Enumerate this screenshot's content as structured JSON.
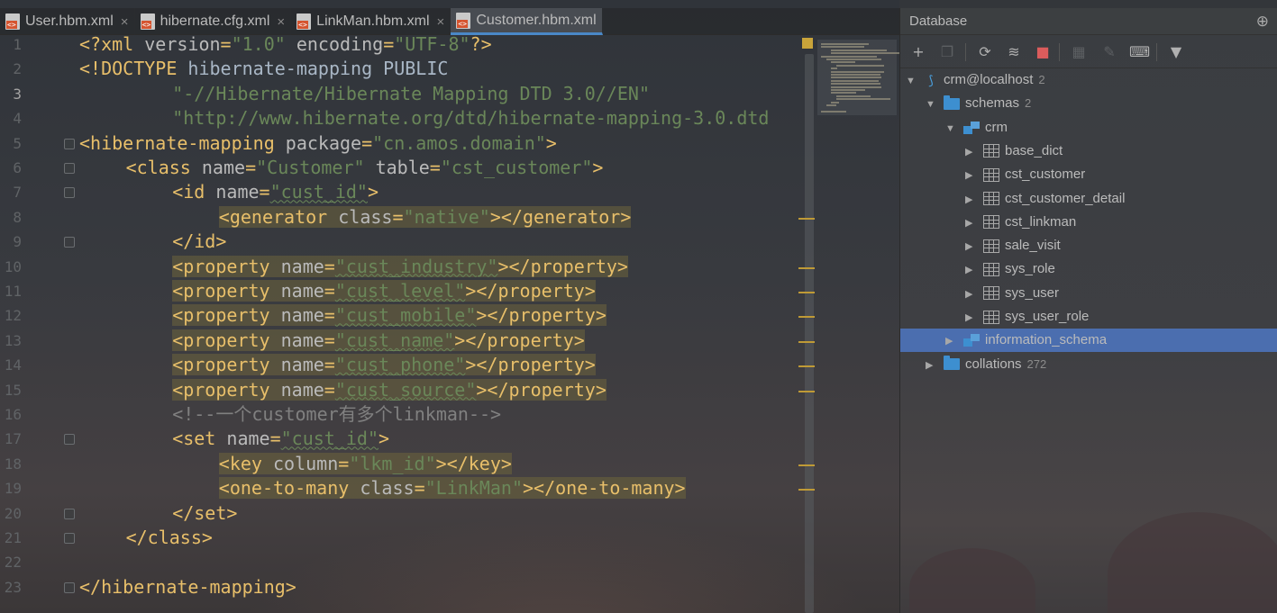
{
  "tabs": [
    {
      "label": "User.hbm.xml",
      "active": false
    },
    {
      "label": "hibernate.cfg.xml",
      "active": false
    },
    {
      "label": "LinkMan.hbm.xml",
      "active": false
    },
    {
      "label": "Customer.hbm.xml",
      "active": true
    }
  ],
  "editor": {
    "current_line": 3,
    "lines": [
      {
        "n": "1",
        "indent": 0,
        "hl": false,
        "tokens": [
          [
            "tag",
            "<?xml "
          ],
          [
            "attr",
            "version"
          ],
          [
            "tag",
            "="
          ],
          [
            "val",
            "\"1.0\""
          ],
          [
            "attr",
            " encoding"
          ],
          [
            "tag",
            "="
          ],
          [
            "val",
            "\"UTF-8\""
          ],
          [
            "tag",
            "?>"
          ]
        ]
      },
      {
        "n": "2",
        "indent": 0,
        "hl": false,
        "tokens": [
          [
            "tag",
            "<!DOCTYPE "
          ],
          [
            "txt",
            "hibernate-mapping PUBLIC"
          ]
        ]
      },
      {
        "n": "3",
        "indent": 8,
        "hl": false,
        "tokens": [
          [
            "val",
            "\"-//Hibernate/Hibernate Mapping DTD 3.0//EN\""
          ]
        ]
      },
      {
        "n": "4",
        "indent": 8,
        "hl": false,
        "tokens": [
          [
            "val",
            "\"http://www.hibernate.org/dtd/hibernate-mapping-3.0.dtd"
          ]
        ]
      },
      {
        "n": "5",
        "indent": 0,
        "hl": false,
        "tokens": [
          [
            "tag",
            "<hibernate-mapping "
          ],
          [
            "attr",
            "package"
          ],
          [
            "tag",
            "="
          ],
          [
            "val",
            "\"cn.amos.domain\""
          ],
          [
            "tag",
            ">"
          ]
        ]
      },
      {
        "n": "6",
        "indent": 4,
        "hl": false,
        "tokens": [
          [
            "tag",
            "<class "
          ],
          [
            "attr",
            "name"
          ],
          [
            "tag",
            "="
          ],
          [
            "val",
            "\"Customer\""
          ],
          [
            "attr",
            " table"
          ],
          [
            "tag",
            "="
          ],
          [
            "val",
            "\"cst_customer\""
          ],
          [
            "tag",
            ">"
          ]
        ]
      },
      {
        "n": "7",
        "indent": 8,
        "hl": false,
        "tokens": [
          [
            "tag",
            "<id "
          ],
          [
            "attr",
            "name"
          ],
          [
            "tag",
            "="
          ],
          [
            "sval",
            "\"cust_id\""
          ],
          [
            "tag",
            ">"
          ]
        ]
      },
      {
        "n": "8",
        "indent": 12,
        "hl": true,
        "tokens": [
          [
            "tag",
            "<generator "
          ],
          [
            "attr",
            "class"
          ],
          [
            "tag",
            "="
          ],
          [
            "val",
            "\"native\""
          ],
          [
            "tag",
            "></generator>"
          ]
        ]
      },
      {
        "n": "9",
        "indent": 8,
        "hl": false,
        "tokens": [
          [
            "tag",
            "</id>"
          ]
        ]
      },
      {
        "n": "10",
        "indent": 8,
        "hl": true,
        "tokens": [
          [
            "tag",
            "<property "
          ],
          [
            "attr",
            "name"
          ],
          [
            "tag",
            "="
          ],
          [
            "sval",
            "\"cust_industry\""
          ],
          [
            "tag",
            "></property>"
          ]
        ]
      },
      {
        "n": "11",
        "indent": 8,
        "hl": true,
        "tokens": [
          [
            "tag",
            "<property "
          ],
          [
            "attr",
            "name"
          ],
          [
            "tag",
            "="
          ],
          [
            "sval",
            "\"cust_level\""
          ],
          [
            "tag",
            "></property>"
          ]
        ]
      },
      {
        "n": "12",
        "indent": 8,
        "hl": true,
        "tokens": [
          [
            "tag",
            "<property "
          ],
          [
            "attr",
            "name"
          ],
          [
            "tag",
            "="
          ],
          [
            "sval",
            "\"cust_mobile\""
          ],
          [
            "tag",
            "></property>"
          ]
        ]
      },
      {
        "n": "13",
        "indent": 8,
        "hl": true,
        "tokens": [
          [
            "tag",
            "<property "
          ],
          [
            "attr",
            "name"
          ],
          [
            "tag",
            "="
          ],
          [
            "sval",
            "\"cust_name\""
          ],
          [
            "tag",
            "></property>"
          ]
        ]
      },
      {
        "n": "14",
        "indent": 8,
        "hl": true,
        "tokens": [
          [
            "tag",
            "<property "
          ],
          [
            "attr",
            "name"
          ],
          [
            "tag",
            "="
          ],
          [
            "sval",
            "\"cust_phone\""
          ],
          [
            "tag",
            "></property>"
          ]
        ]
      },
      {
        "n": "15",
        "indent": 8,
        "hl": true,
        "tokens": [
          [
            "tag",
            "<property "
          ],
          [
            "attr",
            "name"
          ],
          [
            "tag",
            "="
          ],
          [
            "sval",
            "\"cust_source\""
          ],
          [
            "tag",
            "></property>"
          ]
        ]
      },
      {
        "n": "16",
        "indent": 8,
        "hl": false,
        "tokens": [
          [
            "com",
            "<!--一个customer有多个linkman-->"
          ]
        ]
      },
      {
        "n": "17",
        "indent": 8,
        "hl": false,
        "tokens": [
          [
            "tag",
            "<set "
          ],
          [
            "attr",
            "name"
          ],
          [
            "tag",
            "="
          ],
          [
            "sval",
            "\"cust_id\""
          ],
          [
            "tag",
            ">"
          ]
        ]
      },
      {
        "n": "18",
        "indent": 12,
        "hl": true,
        "tokens": [
          [
            "tag",
            "<key "
          ],
          [
            "attr",
            "column"
          ],
          [
            "tag",
            "="
          ],
          [
            "val",
            "\"lkm_id\""
          ],
          [
            "tag",
            "></key>"
          ]
        ]
      },
      {
        "n": "19",
        "indent": 12,
        "hl": true,
        "tokens": [
          [
            "tag",
            "<one-to-many "
          ],
          [
            "attr",
            "class"
          ],
          [
            "tag",
            "="
          ],
          [
            "val",
            "\"LinkMan\""
          ],
          [
            "tag",
            "></one-to-many>"
          ]
        ]
      },
      {
        "n": "20",
        "indent": 8,
        "hl": false,
        "tokens": [
          [
            "tag",
            "</set>"
          ]
        ]
      },
      {
        "n": "21",
        "indent": 4,
        "hl": false,
        "tokens": [
          [
            "tag",
            "</class>"
          ]
        ]
      },
      {
        "n": "22",
        "indent": 0,
        "hl": false,
        "tokens": []
      },
      {
        "n": "23",
        "indent": 0,
        "hl": false,
        "tokens": [
          [
            "tag",
            "</hibernate-mapping>"
          ]
        ]
      }
    ]
  },
  "database": {
    "title": "Database",
    "toolbar_icons": [
      "add-icon",
      "copy-icon",
      "refresh-icon",
      "sync-schema-icon",
      "stop-icon",
      "table-editor-icon",
      "edit-icon",
      "sql-console-icon",
      "filter-icon"
    ],
    "tree": [
      {
        "label": "crm@localhost",
        "count": "2",
        "level": 0,
        "icon": "datasource-icon",
        "expanded": true,
        "selected": false
      },
      {
        "label": "schemas",
        "count": "2",
        "level": 1,
        "icon": "folder-icon",
        "expanded": true,
        "selected": false
      },
      {
        "label": "crm",
        "count": "",
        "level": 2,
        "icon": "schema-icon",
        "expanded": true,
        "selected": false
      },
      {
        "label": "base_dict",
        "count": "",
        "level": 3,
        "icon": "table-icon",
        "expanded": false,
        "selected": false
      },
      {
        "label": "cst_customer",
        "count": "",
        "level": 3,
        "icon": "table-icon",
        "expanded": false,
        "selected": false
      },
      {
        "label": "cst_customer_detail",
        "count": "",
        "level": 3,
        "icon": "table-icon",
        "expanded": false,
        "selected": false
      },
      {
        "label": "cst_linkman",
        "count": "",
        "level": 3,
        "icon": "table-icon",
        "expanded": false,
        "selected": false
      },
      {
        "label": "sale_visit",
        "count": "",
        "level": 3,
        "icon": "table-icon",
        "expanded": false,
        "selected": false
      },
      {
        "label": "sys_role",
        "count": "",
        "level": 3,
        "icon": "table-icon",
        "expanded": false,
        "selected": false
      },
      {
        "label": "sys_user",
        "count": "",
        "level": 3,
        "icon": "table-icon",
        "expanded": false,
        "selected": false
      },
      {
        "label": "sys_user_role",
        "count": "",
        "level": 3,
        "icon": "table-icon",
        "expanded": false,
        "selected": false
      },
      {
        "label": "information_schema",
        "count": "",
        "level": 2,
        "icon": "schema-icon",
        "expanded": false,
        "selected": true
      },
      {
        "label": "collations",
        "count": "272",
        "level": 1,
        "icon": "folder-icon",
        "expanded": false,
        "selected": false
      }
    ]
  },
  "colors": {
    "tag": "#e8bf6a",
    "attr": "#bababa",
    "value": "#6a8759",
    "comment": "#808080",
    "selection": "#4b6eaf",
    "folder": "#3d8fd0"
  }
}
